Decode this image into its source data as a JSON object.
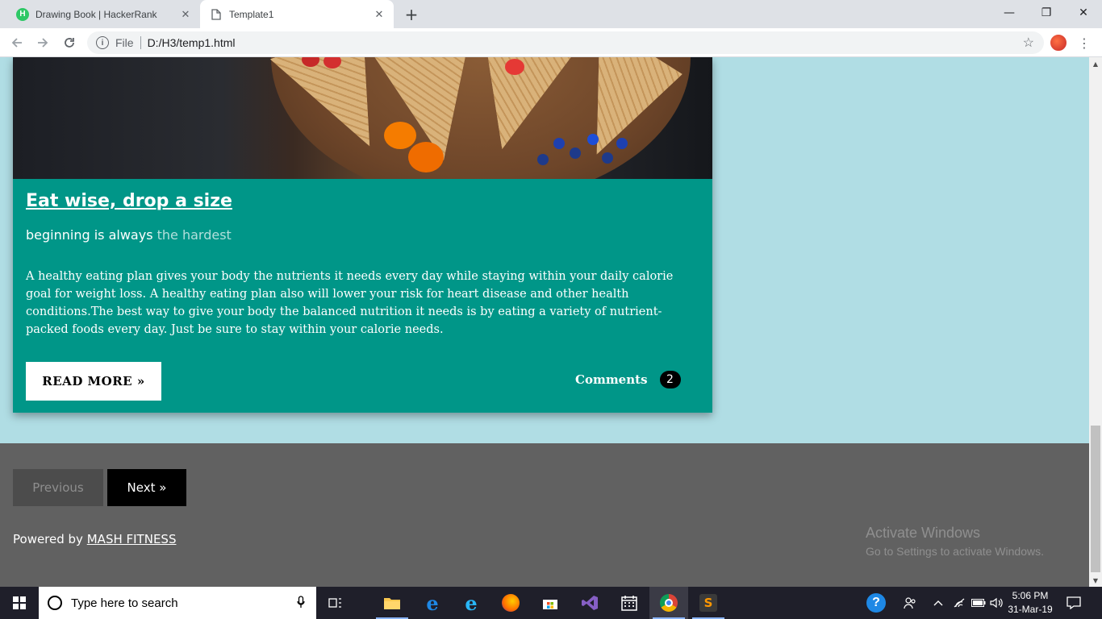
{
  "browser": {
    "tabs": [
      {
        "label": "Drawing Book | HackerRank",
        "favicon": "hackerrank-icon"
      },
      {
        "label": "Template1",
        "favicon": "page-icon"
      }
    ],
    "address": {
      "scheme": "File",
      "url": "D:/H3/temp1.html"
    }
  },
  "card": {
    "title": "Eat wise, drop a size",
    "subtitle_main": "beginning is always",
    "subtitle_muted": "the hardest",
    "body": "A healthy eating plan gives your body the nutrients it needs every day while staying within your daily calorie goal for weight loss. A healthy eating plan also will lower your risk for heart disease and other health conditions.The best way to give your body the balanced nutrition it needs is by eating a variety of nutrient-packed foods every day. Just be sure to stay within your calorie needs.",
    "read_more": "READ MORE »",
    "comments_label": "Comments",
    "comments_count": "2"
  },
  "footer": {
    "prev_label": "Previous",
    "next_label": "Next »",
    "powered_prefix": "Powered by",
    "powered_link": "MASH FITNESS"
  },
  "watermark": {
    "line1": "Activate Windows",
    "line2": "Go to Settings to activate Windows."
  },
  "taskbar": {
    "search_placeholder": "Type here to search",
    "time": "5:06 PM",
    "date": "31-Mar-19"
  },
  "colors": {
    "page_bg": "#b0dde4",
    "card_teal": "#009688",
    "footer_gray": "#616161",
    "taskbar": "#1f1f2a"
  }
}
